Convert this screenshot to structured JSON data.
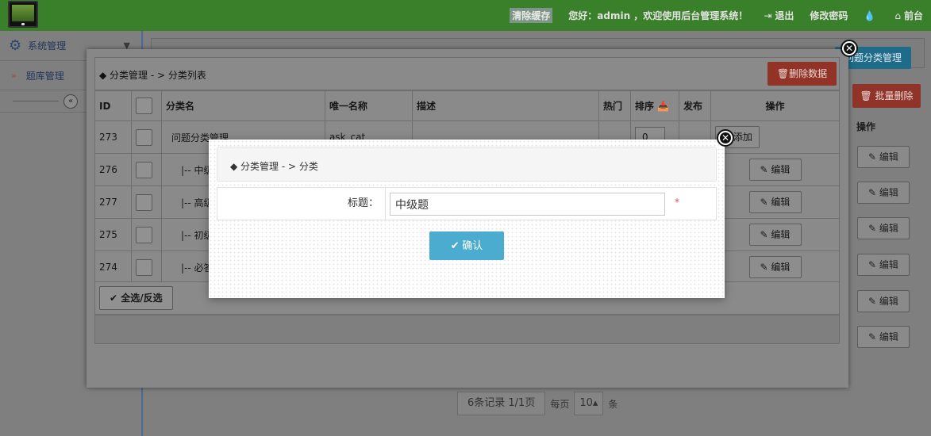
{
  "header": {
    "clear_cache": "清除缓存",
    "greeting": "您好：admin ，欢迎使用后台管理系统！",
    "logout": "退出",
    "change_password": "修改密码",
    "frontend": "前台",
    "icons": {
      "logout": "sign-out-icon",
      "password": "lock-icon",
      "water": "droplet-icon",
      "home": "home-icon"
    }
  },
  "sidebar": {
    "section": "系统管理",
    "items": [
      {
        "label": "题库管理"
      }
    ],
    "collapse_icon": "double-chevron-left-icon"
  },
  "main": {
    "question_category_button": "问题分类管理",
    "bulk_delete": "批量删除",
    "operation_header": "操作",
    "edit_label": "编辑",
    "pagination": {
      "records": "6条记录 1/1页",
      "per_page_label": "每页",
      "per_page_value": "10",
      "unit": "条"
    }
  },
  "modal_category_list": {
    "breadcrumb": "分类管理 - > 分类列表",
    "delete_button": "删除数据",
    "columns": [
      "ID",
      "",
      "分类名",
      "唯一名称",
      "描述",
      "热门",
      "排序",
      "发布",
      "操作"
    ],
    "rows": [
      {
        "id": "273",
        "name": "问题分类管理",
        "unique": "ask_cat",
        "sort": "0",
        "action": "添加"
      },
      {
        "id": "276",
        "name": "|-- 中级题",
        "action": "编辑"
      },
      {
        "id": "277",
        "name": "|-- 高级题",
        "action": "编辑"
      },
      {
        "id": "275",
        "name": "|-- 初级题",
        "action": "编辑"
      },
      {
        "id": "274",
        "name": "|-- 必答题",
        "action": "编辑"
      }
    ],
    "select_all": "全选/反选"
  },
  "modal_edit": {
    "breadcrumb": "分类管理 - > 分类",
    "title_label": "标题：",
    "title_value": "中级题",
    "required_mark": "*",
    "confirm": "确认"
  },
  "colors": {
    "header_bg": "#3a7f29",
    "primary": "#4bacd0",
    "danger": "#d9534f"
  }
}
